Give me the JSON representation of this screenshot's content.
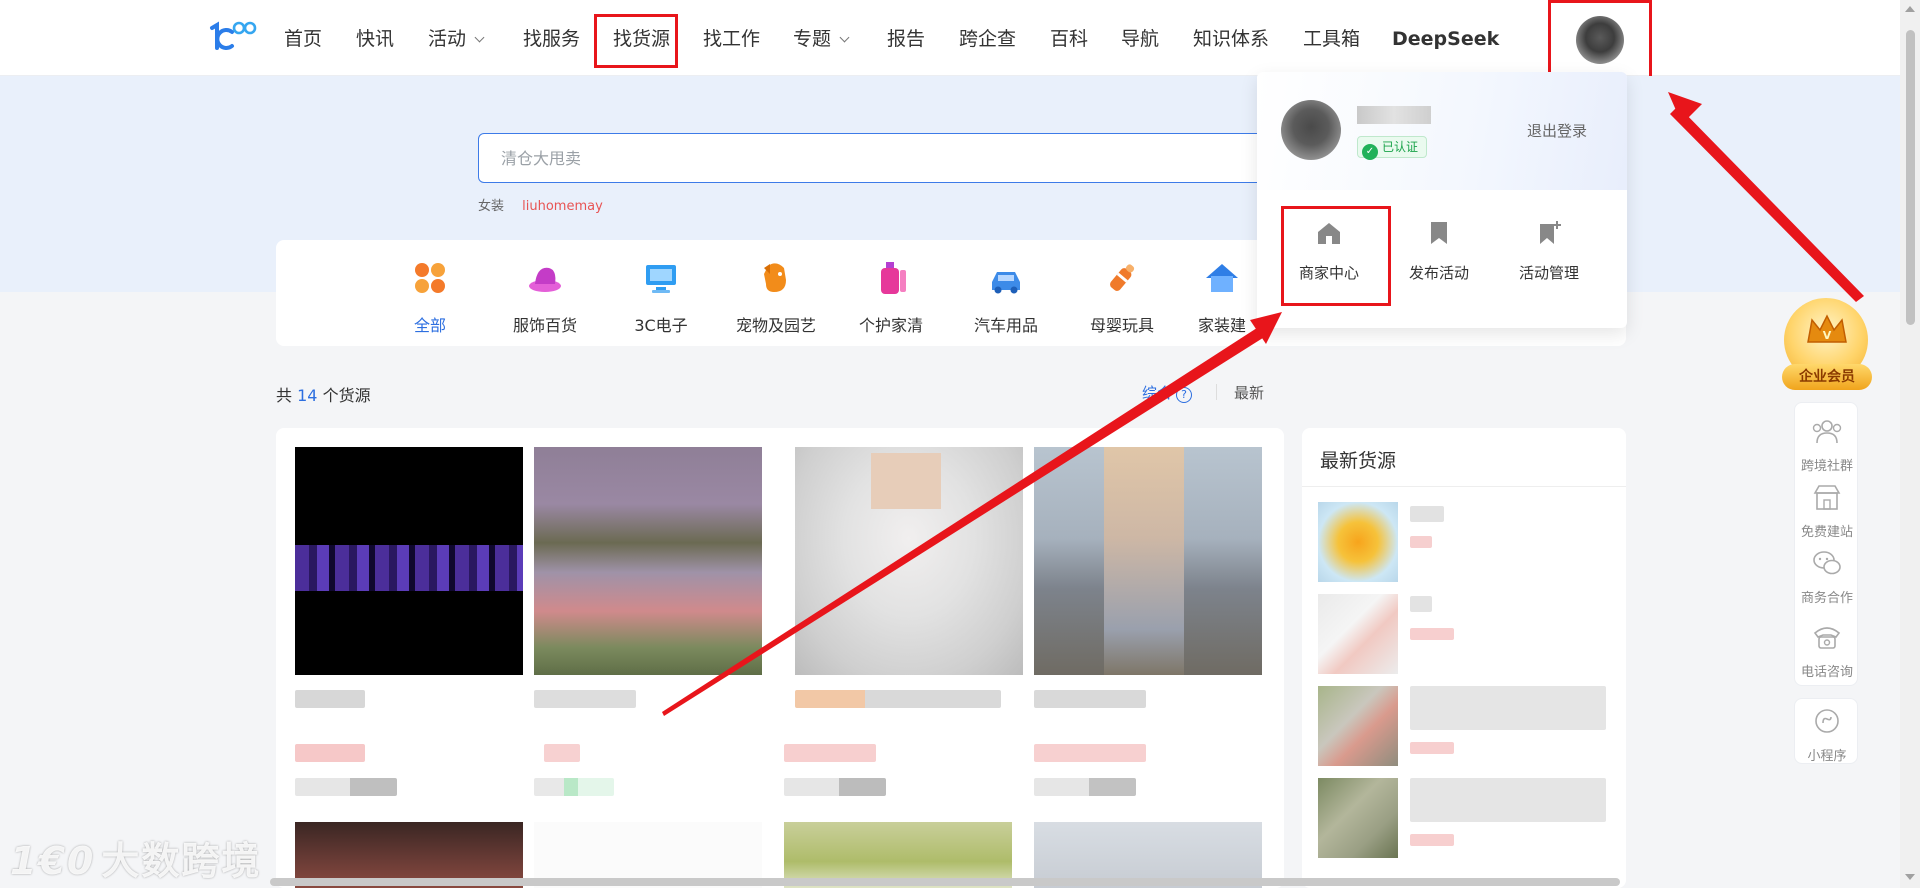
{
  "nav": {
    "items": [
      {
        "label": "首页"
      },
      {
        "label": "快讯"
      },
      {
        "label": "活动"
      },
      {
        "label": "找服务"
      },
      {
        "label": "找货源"
      },
      {
        "label": "找工作"
      },
      {
        "label": "专题"
      },
      {
        "label": "报告"
      },
      {
        "label": "跨企查"
      },
      {
        "label": "百科"
      },
      {
        "label": "导航"
      },
      {
        "label": "知识体系"
      },
      {
        "label": "工具箱"
      },
      {
        "label": "DeepSeek"
      }
    ]
  },
  "search": {
    "placeholder": "清仓大甩卖",
    "hot_tags": [
      "女装",
      "liuhomemay"
    ]
  },
  "categories": [
    {
      "label": "全部",
      "color": "#f47a2a"
    },
    {
      "label": "服饰百货",
      "color": "#d64fd0"
    },
    {
      "label": "3C电子",
      "color": "#2f9df2"
    },
    {
      "label": "宠物及园艺",
      "color": "#f28c1a"
    },
    {
      "label": "个护家清",
      "color": "#e6389a"
    },
    {
      "label": "汽车用品",
      "color": "#3d8be8"
    },
    {
      "label": "母婴玩具",
      "color": "#f07a2a"
    },
    {
      "label": "家装建",
      "color": "#2f7ee6"
    }
  ],
  "listing": {
    "count_prefix": "共",
    "count": "14",
    "count_suffix": "个货源",
    "sort_default": "综合",
    "sort_help": "?",
    "sort_latest": "最新"
  },
  "latest": {
    "title": "最新货源"
  },
  "dropdown": {
    "badge": "已认证",
    "logout": "退出登录",
    "actions": [
      {
        "label": "商家中心"
      },
      {
        "label": "发布活动"
      },
      {
        "label": "活动管理"
      }
    ]
  },
  "sidebar": {
    "vip_label": "企业会员",
    "items": [
      {
        "label": "跨境社群"
      },
      {
        "label": "免费建站"
      },
      {
        "label": "商务合作"
      },
      {
        "label": "电话咨询"
      }
    ],
    "mini_program": "小程序"
  },
  "watermark": {
    "logo": "1€0",
    "text": "大数跨境"
  },
  "colors": {
    "accent": "#2d6fe0",
    "highlight": "#e8151b",
    "verified": "#22b15a"
  }
}
